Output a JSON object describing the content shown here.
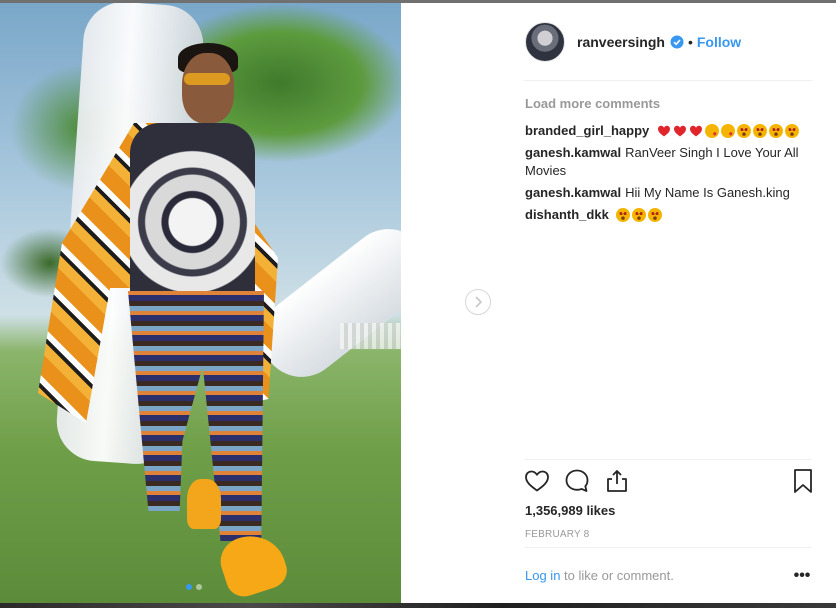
{
  "post": {
    "username": "ranveersingh",
    "separator": "•",
    "follow_label": "Follow",
    "load_more_label": "Load more comments",
    "likes_label": "1,356,989 likes",
    "date_label": "FEBRUARY 8",
    "login_link": "Log in",
    "login_suffix": " to like or comment.",
    "more_label": "•••"
  },
  "comments": [
    {
      "user": "branded_girl_happy",
      "text": ""
    },
    {
      "user": "ganesh.kamwal",
      "text": "RanVeer Singh I Love Your All Movies"
    },
    {
      "user": "ganesh.kamwal",
      "text": "Hii My Name Is Ganesh.king"
    },
    {
      "user": "dishanth_dkk",
      "text": ""
    }
  ],
  "icons": {
    "heart": "heart-icon",
    "comment": "comment-icon",
    "share": "share-icon",
    "save": "bookmark-icon",
    "next": "chevron-right-icon",
    "verified": "verified-badge-icon"
  },
  "colors": {
    "accent": "#3897f0",
    "text": "#262626",
    "muted": "#999999",
    "divider": "#efefef"
  },
  "carousel": {
    "current_index": 1,
    "total": 2
  }
}
